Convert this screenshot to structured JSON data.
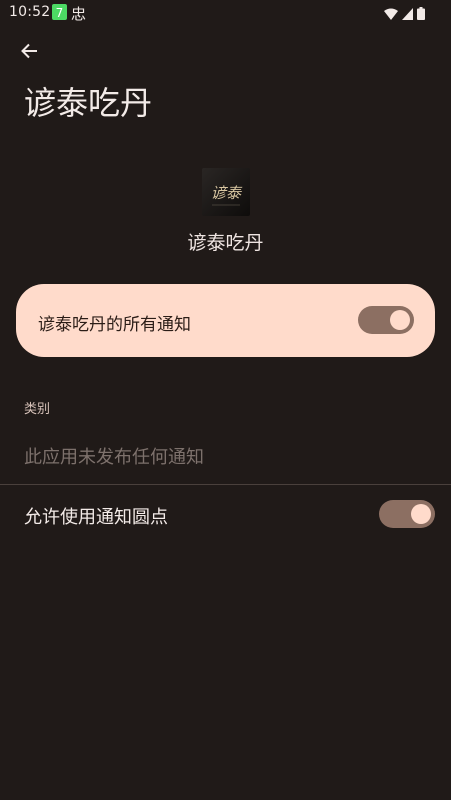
{
  "status_bar": {
    "time": "10:52",
    "app_badge_char": "7",
    "app_badge_color": "#4cd964",
    "chinese_char": "忠",
    "icons": [
      "wifi-icon",
      "signal-icon",
      "battery-icon"
    ]
  },
  "header": {
    "back_icon": "arrow-left-icon",
    "title": "谚泰吃丹"
  },
  "app": {
    "icon_label": "谚泰",
    "name": "谚泰吃丹"
  },
  "master_toggle": {
    "label": "谚泰吃丹的所有通知",
    "on": true
  },
  "categories": {
    "header": "类别",
    "empty_text": "此应用未发布任何通知"
  },
  "dot_toggle": {
    "label": "允许使用通知圆点",
    "on": true
  },
  "colors": {
    "background": "#201a18",
    "card": "#ffdbcb",
    "switch_track": "#8c6f62"
  }
}
